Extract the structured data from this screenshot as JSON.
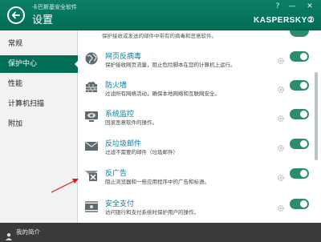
{
  "header": {
    "app_title": "卡巴斯基安全软件",
    "page_title": "设置",
    "help": "?",
    "minimize": "—",
    "close": "✕",
    "logo": "KASPERSKY②"
  },
  "sidebar": {
    "items": [
      {
        "label": "常规",
        "active": false
      },
      {
        "label": "保护中心",
        "active": true
      },
      {
        "label": "性能",
        "active": false
      },
      {
        "label": "计算机扫描",
        "active": false
      },
      {
        "label": "附加",
        "active": false
      }
    ]
  },
  "content": {
    "cut_off_text": "保护接收或发送的邮件中带有的病毒和恶意软件。",
    "rows": [
      {
        "title": "网页反病毒",
        "desc": "保护接收网页流量，阻止危险脚本在您的计算机上运行。",
        "icon": "globe-icon",
        "enabled": true
      },
      {
        "title": "防火墙",
        "desc": "过滤所有网络活动，确保本地网络和互联网安全。",
        "icon": "firewall-icon",
        "enabled": true
      },
      {
        "title": "系统监控",
        "desc": "回滚恶意软件的操作。",
        "icon": "eye-monitor-icon",
        "enabled": true
      },
      {
        "title": "反垃圾邮件",
        "desc": "过滤不需要的邮件（垃圾邮件）",
        "icon": "mail-icon",
        "enabled": true
      },
      {
        "title": "反广告",
        "desc": "阻止浏览器和一些应用程序中的广告和标语。",
        "icon": "anti-banner-icon",
        "enabled": true
      },
      {
        "title": "安全支付",
        "desc": "访问银行和支付系统时保护用户的操作。",
        "icon": "safe-money-icon",
        "enabled": true
      }
    ]
  },
  "footer": {
    "link": "我的简介"
  },
  "colors": {
    "header_bg": "#006d56",
    "accent": "#2d8c6e",
    "title_link": "#0a7a98",
    "annotation_arrow": "#d42020"
  }
}
